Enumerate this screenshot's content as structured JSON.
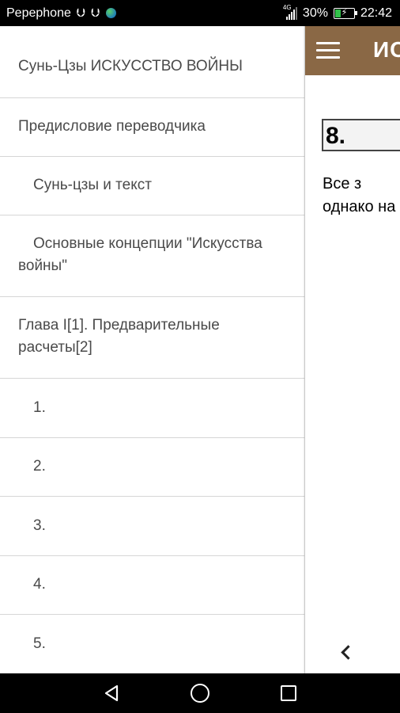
{
  "status_bar": {
    "carrier": "Pepephone",
    "network": "4G",
    "battery_percent": "30%",
    "battery_level": 0.3,
    "time": "22:42",
    "icons": [
      "usb-icon",
      "usb-icon",
      "globe-icon",
      "signal-icon",
      "battery-charging-icon"
    ]
  },
  "app_bar": {
    "title": "ИС",
    "menu_icon": "hamburger-menu-icon",
    "color": "#8a6845"
  },
  "content": {
    "heading": "8.",
    "body": "Все з\nоднако на",
    "prev_icon": "chevron-left-icon"
  },
  "drawer": {
    "items": [
      {
        "label": "Сунь-Цзы ИСКУССТВО ВОЙНЫ"
      },
      {
        "label": "Предисловие переводчика"
      },
      {
        "label": "Сунь-цзы и текст"
      },
      {
        "label": "Основные концепции \"Искусства войны\""
      },
      {
        "label": "Глава I[1]. Предварительные расчеты[2]"
      },
      {
        "label": "1."
      },
      {
        "label": "2."
      },
      {
        "label": "3."
      },
      {
        "label": "4."
      },
      {
        "label": "5."
      }
    ]
  },
  "nav_bar": {
    "icons": [
      "back-triangle-icon",
      "home-circle-icon",
      "recents-square-icon"
    ]
  }
}
